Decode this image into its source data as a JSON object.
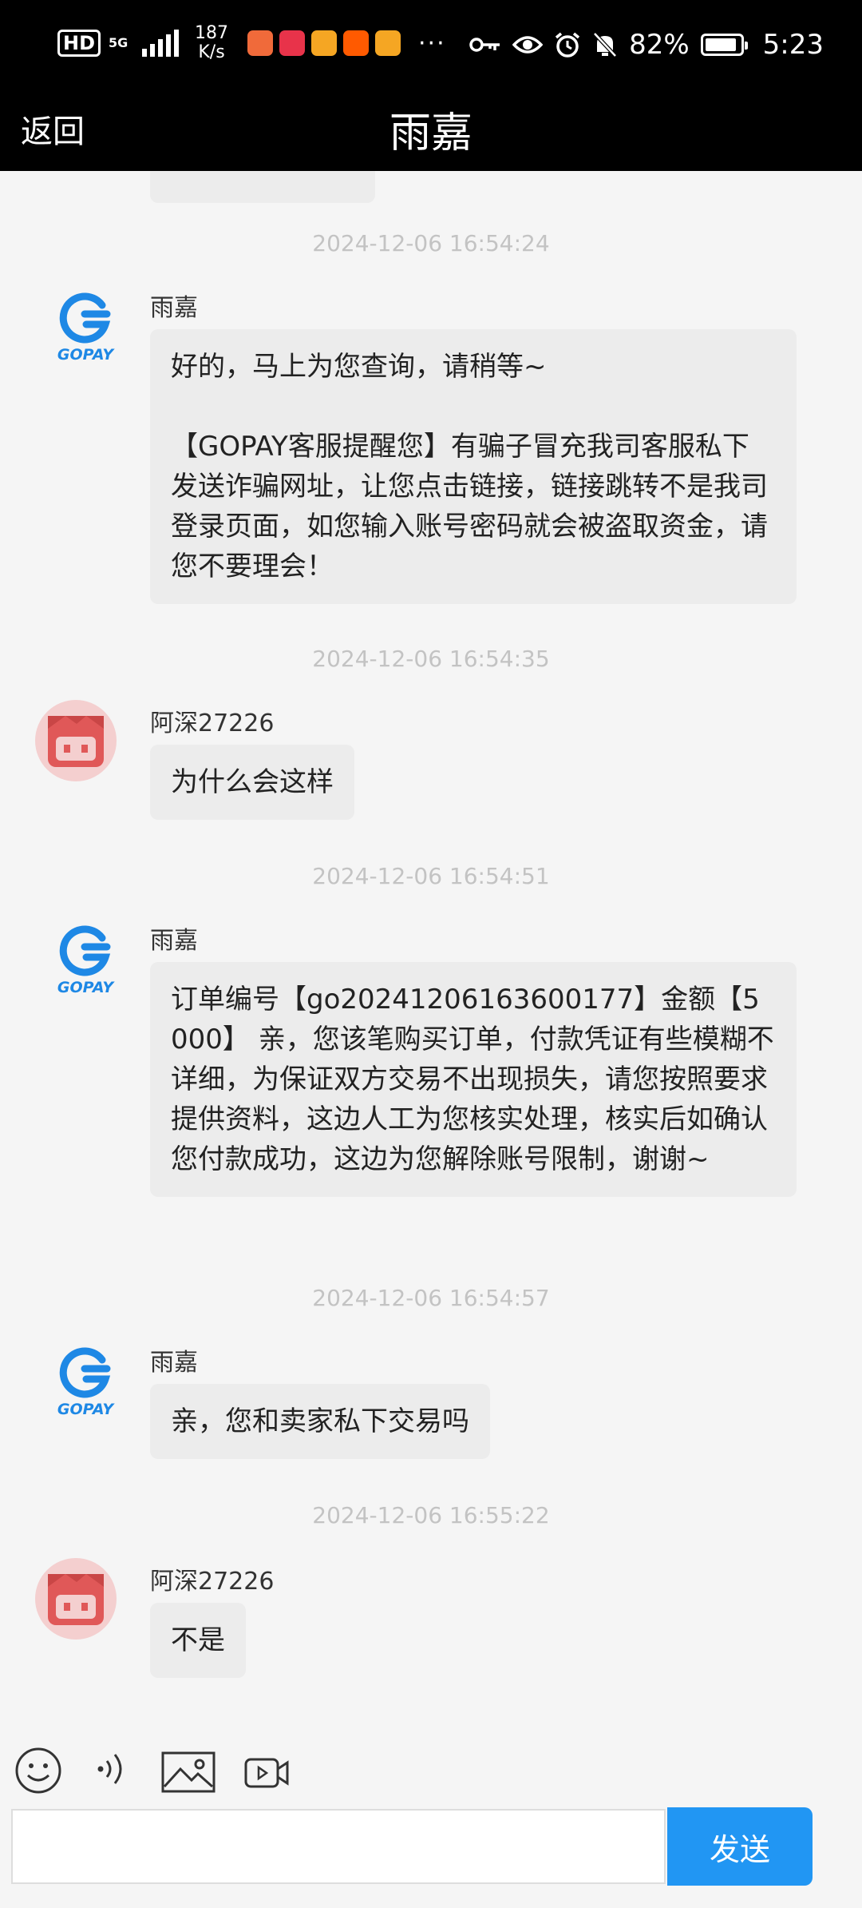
{
  "status_bar": {
    "hd": "HD",
    "network": "5G",
    "speed_value": "187",
    "speed_unit": "K/s",
    "more": "···",
    "battery": "82%",
    "time": "5:23"
  },
  "header": {
    "back_label": "返回",
    "title": "雨嘉"
  },
  "avatar_text": "GOPAY",
  "messages": [
    {
      "timestamp": "2024-12-06 16:54:24",
      "sender": "雨嘉",
      "text": "好的，马上为您查询，请稍等~\n\n【GOPAY客服提醒您】有骗子冒充我司客服私下发送诈骗网址，让您点击链接，链接跳转不是我司登录页面，如您输入账号密码就会被盗取资金，请您不要理会！"
    },
    {
      "timestamp": "2024-12-06 16:54:35",
      "sender": "阿深27226",
      "text": "为什么会这样"
    },
    {
      "timestamp": "2024-12-06 16:54:51",
      "sender": "雨嘉",
      "text": "订单编号【go20241206163600177】金额【5000】 亲，您该笔购买订单，付款凭证有些模糊不详细，为保证双方交易不出现损失，请您按照要求提供资料，这边人工为您核实处理，核实后如确认您付款成功，这边为您解除账号限制，谢谢~"
    },
    {
      "timestamp": "2024-12-06 16:54:57",
      "sender": "雨嘉",
      "text": "亲，您和卖家私下交易吗"
    },
    {
      "timestamp": "2024-12-06 16:55:22",
      "sender": "阿深27226",
      "text": "不是"
    }
  ],
  "composer": {
    "input_value": "",
    "send_label": "发送"
  },
  "colors": {
    "send_button": "#2196f3",
    "bubble": "#ececec",
    "gopay_blue": "#1e88e5",
    "user_avatar": "#e05858"
  }
}
